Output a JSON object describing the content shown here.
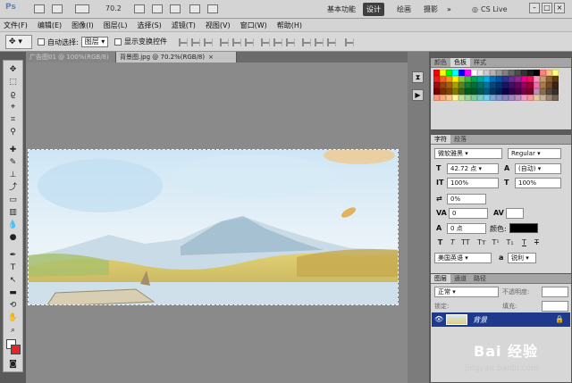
{
  "app": {
    "logo": "Ps",
    "zoom": "70.2",
    "workspaces": [
      "基本功能",
      "设计",
      "绘画",
      "摄影"
    ],
    "active_workspace": "设计",
    "cs_live": "CS Live"
  },
  "menu": [
    "文件(F)",
    "编辑(E)",
    "图像(I)",
    "图层(L)",
    "选择(S)",
    "滤镜(T)",
    "视图(V)",
    "窗口(W)",
    "帮助(H)"
  ],
  "options": {
    "auto_select_label": "自动选择:",
    "auto_select_value": "图层",
    "show_transform_label": "显示变换控件"
  },
  "doc_tabs": [
    {
      "label": "广告图01 @ 100%(RGB/8)",
      "active": false
    },
    {
      "label": "背景图.jpg @ 70.2%(RGB/8)",
      "active": true
    }
  ],
  "panels": {
    "swatch_tabs": [
      "颜色",
      "色板",
      "样式"
    ],
    "char_tabs": [
      "字符",
      "段落"
    ],
    "font_family": "微软雅黑",
    "font_style": "Regular",
    "font_size": "42.72 点",
    "leading": "(自动)",
    "vscale": "100%",
    "hscale": "100%",
    "tracking": "0%",
    "kerning": "0",
    "baseline": "0 点",
    "color_label": "颜色:",
    "language": "美国英语",
    "aa_label": "a",
    "aa_value": "锐利",
    "layer_tabs": [
      "图层",
      "通道",
      "路径"
    ],
    "blend_mode": "正常",
    "opacity_label": "不透明度:",
    "lock_label": "锁定:",
    "fill_label": "填充:",
    "layer_name": "背景"
  },
  "watermark": {
    "brand": "Bai 经验",
    "url": "jingyan.baidu.com"
  },
  "colors": {
    "swatches": [
      "#ff0000",
      "#ffff00",
      "#00ff00",
      "#00ffff",
      "#0000ff",
      "#ff00ff",
      "#ffffff",
      "#e6e6e6",
      "#cccccc",
      "#b3b3b3",
      "#999999",
      "#808080",
      "#666666",
      "#4d4d4d",
      "#333333",
      "#1a1a1a",
      "#000000",
      "#ff8080",
      "#ffc080",
      "#ffff80",
      "#ed1c24",
      "#f26522",
      "#f7941d",
      "#fff200",
      "#8dc63f",
      "#39b54a",
      "#00a651",
      "#00a99d",
      "#00aeef",
      "#0072bc",
      "#0054a6",
      "#2e3192",
      "#662d91",
      "#92278f",
      "#ec008c",
      "#ed145b",
      "#f49ac1",
      "#c69c6d",
      "#8c6239",
      "#603913",
      "#9e0b0f",
      "#a0410d",
      "#a36209",
      "#aba000",
      "#598527",
      "#197b30",
      "#007236",
      "#00746b",
      "#0076a3",
      "#004a80",
      "#003471",
      "#1b1464",
      "#440e62",
      "#630460",
      "#9e005d",
      "#9e0039",
      "#f06eaa",
      "#a67c52",
      "#754c24",
      "#3c2415",
      "#790000",
      "#7b2e00",
      "#7d4900",
      "#827b00",
      "#406618",
      "#005e20",
      "#005826",
      "#005952",
      "#005b7f",
      "#003663",
      "#002157",
      "#0d004c",
      "#32004b",
      "#4b0049",
      "#7b0046",
      "#7a0026",
      "#bd8cbf",
      "#8b6e4e",
      "#534741",
      "#362f2d",
      "#f7977a",
      "#f9ad81",
      "#fdc68a",
      "#fff79a",
      "#c4df9b",
      "#a2d39c",
      "#82ca9d",
      "#7bcdc8",
      "#6ecff6",
      "#7ea7d8",
      "#8493ca",
      "#8882be",
      "#a187be",
      "#bc8dbf",
      "#f49ac2",
      "#f6989d",
      "#e2c8a0",
      "#c7b299",
      "#998675",
      "#736357"
    ]
  }
}
